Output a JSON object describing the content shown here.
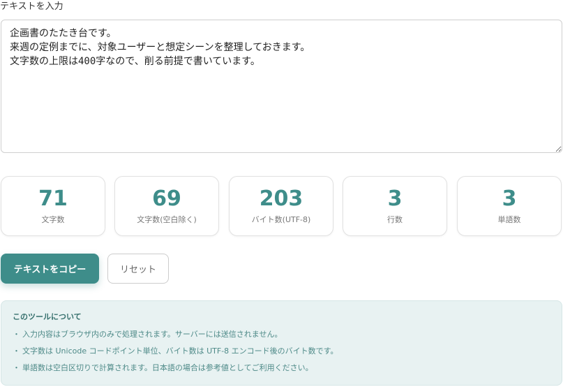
{
  "input": {
    "label": "テキストを入力",
    "value": "企画書のたたき台です。\n来週の定例までに、対象ユーザーと想定シーンを整理しておきます。\n文字数の上限は400字なので、削る前提で書いています。"
  },
  "stats": [
    {
      "value": "71",
      "label": "文字数"
    },
    {
      "value": "69",
      "label": "文字数(空白除く)"
    },
    {
      "value": "203",
      "label": "バイト数(UTF-8)"
    },
    {
      "value": "3",
      "label": "行数"
    },
    {
      "value": "3",
      "label": "単語数"
    }
  ],
  "buttons": {
    "copy_label": "テキストをコピー",
    "reset_label": "リセット"
  },
  "info": {
    "title": "このツールについて",
    "bullet": "・",
    "items": [
      "入力内容はブラウザ内のみで処理されます。サーバーには送信されません。",
      "文字数は Unicode コードポイント単位、バイト数は UTF-8 エンコード後のバイト数です。",
      "単語数は空白区切りで計算されます。日本語の場合は参考値としてご利用ください。"
    ]
  },
  "colors": {
    "accent": "#3e8d8a",
    "info_background": "#e8f2f2",
    "info_text": "#4e8a88"
  }
}
